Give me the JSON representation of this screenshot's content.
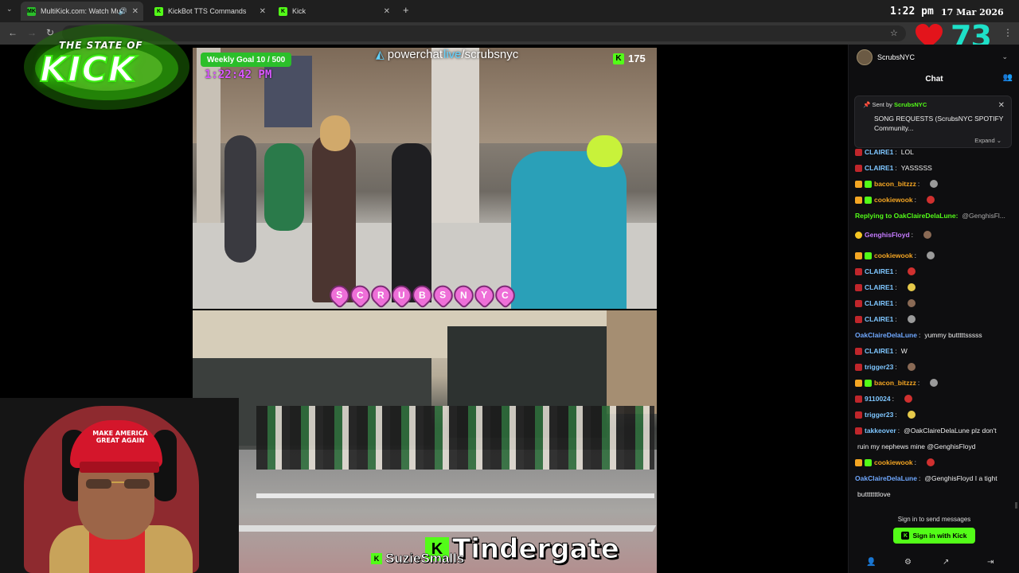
{
  "browser": {
    "tabs": [
      {
        "label": "MultiKick.com: Watch Mult",
        "favicon": "MK"
      },
      {
        "label": "KickBot TTS Commands",
        "favicon": "K"
      },
      {
        "label": "Kick",
        "favicon": "K"
      }
    ],
    "new_tab": "+"
  },
  "overlay": {
    "clock": "1:22 pm",
    "date": "17 Mar 2026",
    "heart_count": "73",
    "logo_top": "THE STATE OF",
    "logo_main": "KICK"
  },
  "stream1": {
    "goal": "Weekly Goal 10 / 500",
    "time": "1:22:42 PM",
    "powerchat_site": "powerchat",
    "powerchat_live": "live",
    "powerchat_path": "/scrubsnyc",
    "viewers": "175",
    "name_letters": [
      "S",
      "C",
      "R",
      "U",
      "B",
      "S",
      "N",
      "Y",
      "C"
    ]
  },
  "webcam": {
    "cap_text": "MAKE AMERICA GREAT AGAIN"
  },
  "captions": {
    "main": "Tindergate",
    "sub": "SuzieSmalls"
  },
  "chat": {
    "channel": "ScrubsNYC",
    "title": "Chat",
    "pinned": {
      "sent_by": "Sent by",
      "sender": "ScrubsNYC",
      "text": "SONG REQUESTS (ScrubsNYC SPOTIFY Community...",
      "expand": "Expand"
    },
    "messages": [
      {
        "user": "CLAIRE1",
        "color": "#7ec6ff",
        "text": "LOL"
      },
      {
        "user": "CLAIRE1",
        "color": "#7ec6ff",
        "text": "YASSSSS"
      },
      {
        "user": "bacon_bitzzz",
        "color": "#f5a623",
        "text": ""
      },
      {
        "user": "cookiewook",
        "color": "#f5a623",
        "text": ""
      },
      {
        "user": "Replying to OakClaireDelaLune:",
        "color": "#53fc18",
        "text": "@GenghisFl..."
      },
      {
        "user": "GenghisFloyd",
        "color": "#c57bff",
        "text": ""
      },
      {
        "user": "cookiewook",
        "color": "#f5a623",
        "text": ""
      },
      {
        "user": "CLAIRE1",
        "color": "#7ec6ff",
        "text": ""
      },
      {
        "user": "CLAIRE1",
        "color": "#7ec6ff",
        "text": ""
      },
      {
        "user": "CLAIRE1",
        "color": "#7ec6ff",
        "text": ""
      },
      {
        "user": "CLAIRE1",
        "color": "#7ec6ff",
        "text": ""
      },
      {
        "user": "OakClaireDelaLune",
        "color": "#6fa8ff",
        "text": "yummy butttttsssss"
      },
      {
        "user": "CLAIRE1",
        "color": "#7ec6ff",
        "text": "W"
      },
      {
        "user": "trigger23",
        "color": "#7ec6ff",
        "text": ""
      },
      {
        "user": "bacon_bitzzz",
        "color": "#f5a623",
        "text": ""
      },
      {
        "user": "9110024",
        "color": "#7ec6ff",
        "text": ""
      },
      {
        "user": "trigger23",
        "color": "#7ec6ff",
        "text": ""
      },
      {
        "user": "takkeover",
        "color": "#7ec6ff",
        "text": "@OakClaireDelaLune plz don't"
      },
      {
        "user": "",
        "color": "#eee",
        "text": "ruin my nephews mine @GenghisFloyd"
      },
      {
        "user": "cookiewook",
        "color": "#f5a623",
        "text": ""
      },
      {
        "user": "OakClaireDelaLune",
        "color": "#6fa8ff",
        "text": "@GenghisFloyd I a tight"
      },
      {
        "user": "",
        "color": "#eee",
        "text": "butttttttlove"
      }
    ],
    "signin_text": "Sign in to send messages",
    "signin_button": "Sign in with Kick"
  }
}
